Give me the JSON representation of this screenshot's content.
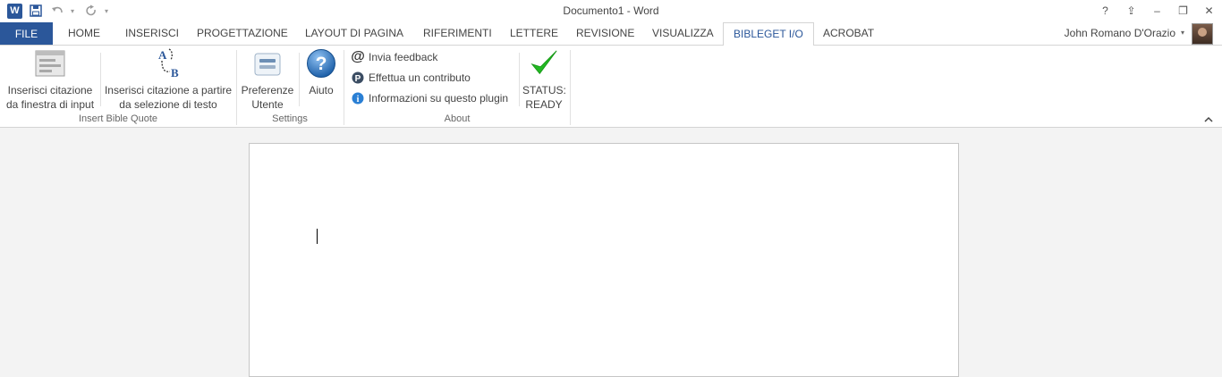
{
  "window": {
    "title": "Documento1 - Word",
    "app_icon_letter": "W",
    "controls": [
      "?",
      "⇪",
      "–",
      "❐",
      "✕"
    ]
  },
  "tabs": {
    "file": "FILE",
    "items": [
      "HOME",
      "INSERISCI",
      "PROGETTAZIONE",
      "LAYOUT DI PAGINA",
      "RIFERIMENTI",
      "LETTERE",
      "REVISIONE",
      "VISUALIZZA",
      "BIBLEGET I/O",
      "ACROBAT"
    ],
    "active": "BIBLEGET I/O"
  },
  "user": {
    "name": "John Romano D'Orazio"
  },
  "ribbon": {
    "insert_group": {
      "label": "Insert Bible Quote",
      "btn_input": {
        "line1": "Inserisci citazione",
        "line2": "da finestra di input"
      },
      "btn_selection": {
        "line1": "Inserisci citazione a partire",
        "line2": "da selezione di testo"
      },
      "btn_selection_icon_letters": {
        "a": "A",
        "b": "B"
      }
    },
    "settings_group": {
      "label": "Settings",
      "btn_prefs": {
        "line1": "Preferenze",
        "line2": "Utente"
      },
      "btn_help": {
        "line1": "Aiuto"
      }
    },
    "about_group": {
      "label": "About",
      "items": [
        "Invia feedback",
        "Effettua un contributo",
        "Informazioni su questo plugin"
      ]
    },
    "status": {
      "line1": "STATUS:",
      "line2": "READY"
    }
  },
  "colors": {
    "accent": "#2b579a",
    "status_check": "#22b922"
  }
}
